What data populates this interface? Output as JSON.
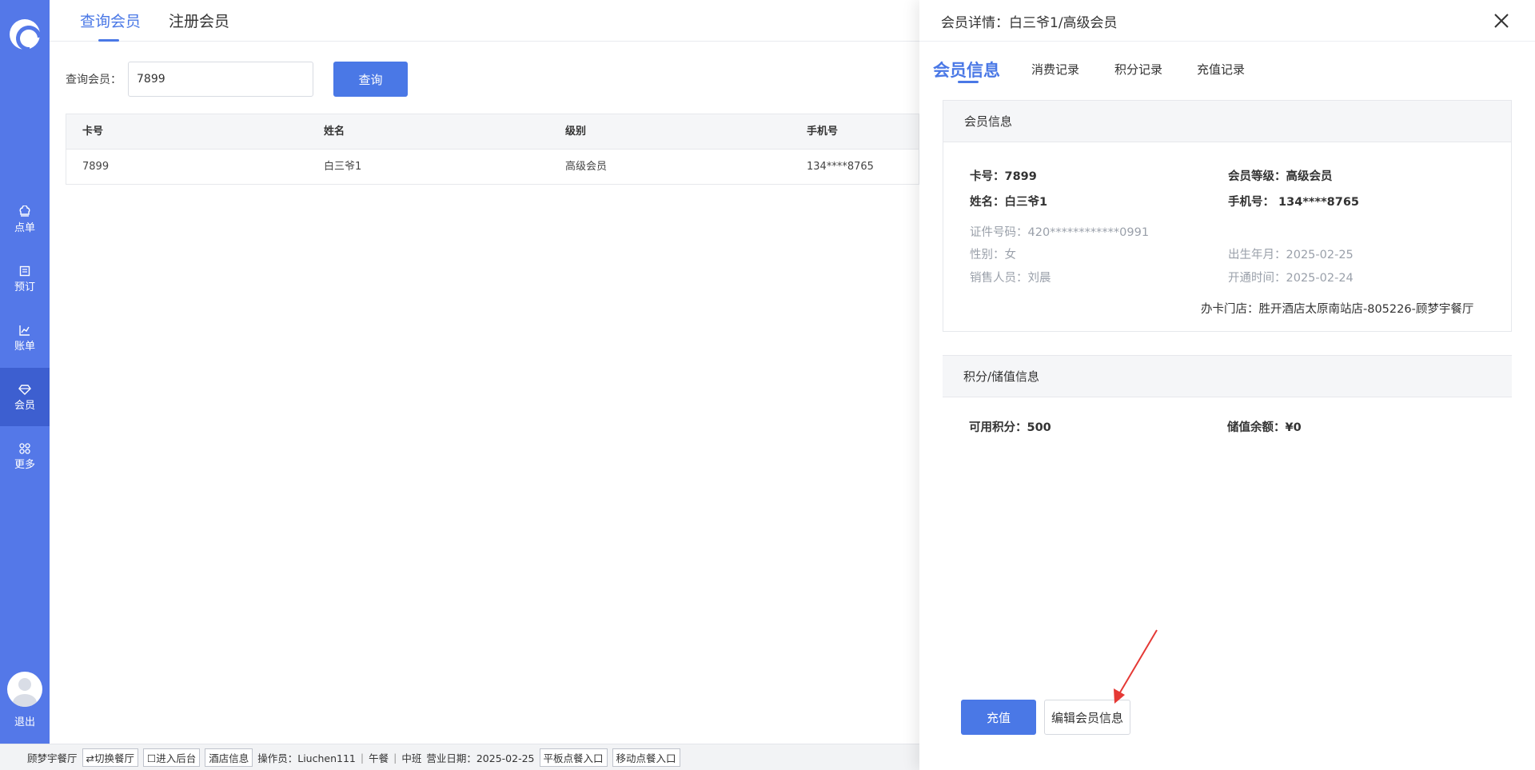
{
  "sidebar": {
    "items": [
      {
        "label": "点单",
        "icon": "chef-hat-icon"
      },
      {
        "label": "预订",
        "icon": "reservation-icon"
      },
      {
        "label": "账单",
        "icon": "chart-icon"
      },
      {
        "label": "会员",
        "icon": "diamond-icon",
        "active": true
      },
      {
        "label": "更多",
        "icon": "grid-icon"
      }
    ],
    "logout_label": "退出"
  },
  "main": {
    "tabs": [
      {
        "label": "查询会员",
        "active": true
      },
      {
        "label": "注册会员",
        "active": false
      }
    ],
    "search": {
      "label": "查询会员：",
      "value": "7899",
      "button": "查询"
    },
    "table": {
      "headers": [
        "卡号",
        "姓名",
        "级别",
        "手机号"
      ],
      "rows": [
        [
          "7899",
          "白三爷1",
          "高级会员",
          "134****8765"
        ]
      ]
    }
  },
  "statusbar": {
    "restaurant": "顾梦宇餐厅",
    "switch": "⇄切换餐厅",
    "backend": "☐进入后台",
    "hotel_info": "酒店信息",
    "operator": "操作员：Liuchen111",
    "meal": "午餐",
    "shift": "中班",
    "business_date": "营业日期：2025-02-25",
    "tablet_entry": "平板点餐入口",
    "mobile_entry": "移动点餐入口"
  },
  "drawer": {
    "title": "会员详情：白三爷1/高级会员",
    "tabs": [
      {
        "label": "会员信息",
        "active": true
      },
      {
        "label": "消费记录",
        "active": false
      },
      {
        "label": "积分记录",
        "active": false
      },
      {
        "label": "充值记录",
        "active": false
      }
    ],
    "info_card": {
      "title": "会员信息",
      "card_no": "卡号：7899",
      "level": "会员等级：高级会员",
      "name": "姓名：白三爷1",
      "phone": "手机号：  134****8765",
      "id_no": "证件号码：420************0991",
      "gender": "性别：女",
      "birth": "出生年月：2025-02-25",
      "sales": "销售人员：刘晨",
      "open_time": "开通时间：2025-02-24",
      "store": "办卡门店：胜开酒店太原南站店-805226-顾梦宇餐厅"
    },
    "points_card": {
      "title": "积分/储值信息",
      "points": "可用积分：500",
      "balance": "储值余额：¥0"
    },
    "buttons": {
      "recharge": "充值",
      "edit": "编辑会员信息"
    }
  },
  "colors": {
    "sidebar": "#5478e8",
    "accent": "#4a78e6",
    "arrow": "#e53935"
  }
}
